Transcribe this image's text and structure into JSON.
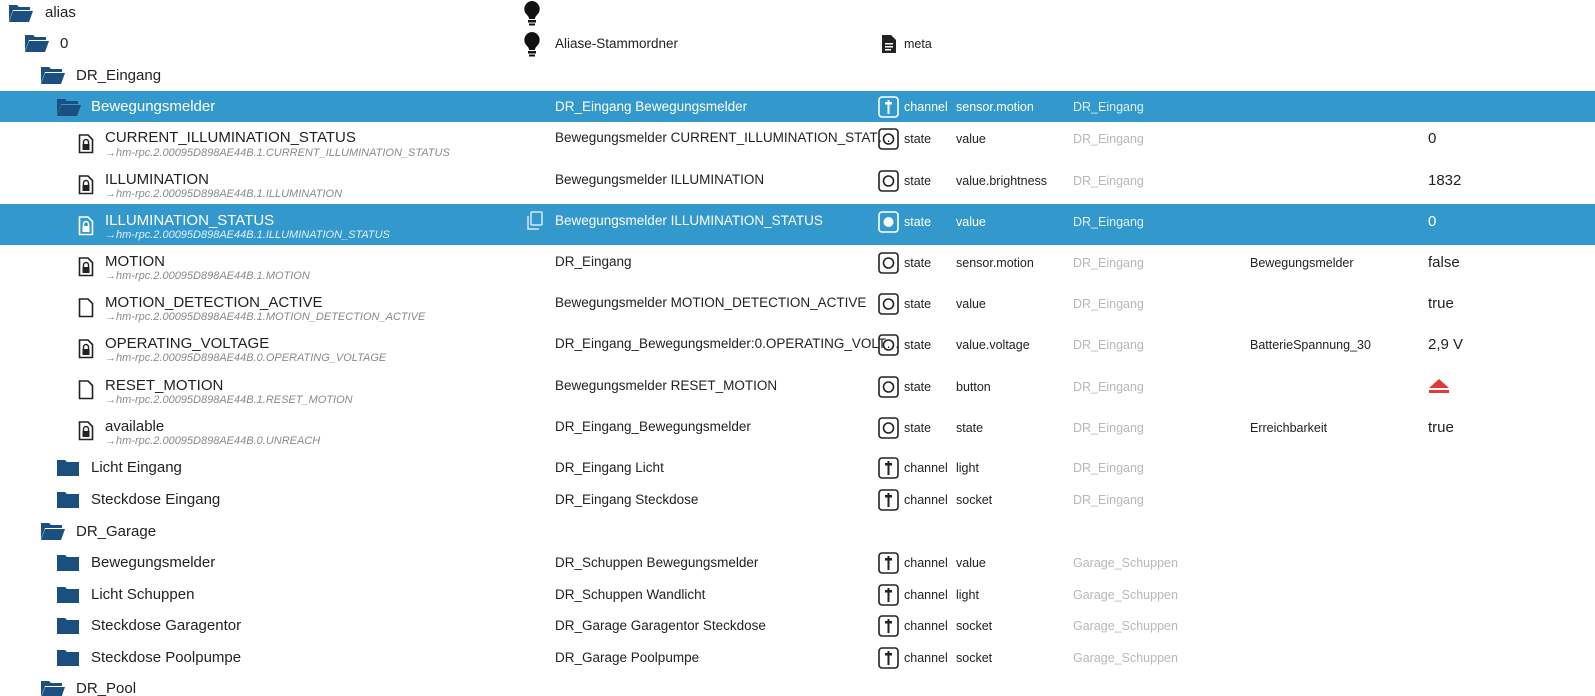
{
  "folders": [
    {
      "name": "alias",
      "title": ""
    },
    {
      "name": "0",
      "title": "Aliase-Stammordner",
      "type": "meta"
    },
    {
      "name": "DR_Eingang"
    },
    {
      "name": "Bewegungsmelder",
      "title": "DR_Eingang Bewegungsmelder",
      "type": "channel",
      "role": "sensor.motion",
      "room": "DR_Eingang"
    }
  ],
  "states": [
    {
      "name": "CURRENT_ILLUMINATION_STATUS",
      "alias": "→hm-rpc.2.00095D898AE44B.1.CURRENT_ILLUMINATION_STATUS",
      "title": "Bewegungsmelder CURRENT_ILLUMINATION_STAT…",
      "type": "state",
      "role": "value",
      "room": "DR_Eingang",
      "function": "",
      "value": "0"
    },
    {
      "name": "ILLUMINATION",
      "alias": "→hm-rpc.2.00095D898AE44B.1.ILLUMINATION",
      "title": "Bewegungsmelder ILLUMINATION",
      "type": "state",
      "role": "value.brightness",
      "room": "DR_Eingang",
      "function": "",
      "value": "1832"
    },
    {
      "name": "ILLUMINATION_STATUS",
      "alias": "→hm-rpc.2.00095D898AE44B.1.ILLUMINATION_STATUS",
      "title": "Bewegungsmelder ILLUMINATION_STATUS",
      "type": "state",
      "role": "value",
      "room": "DR_Eingang",
      "function": "",
      "value": "0"
    },
    {
      "name": "MOTION",
      "alias": "→hm-rpc.2.00095D898AE44B.1.MOTION",
      "title": "DR_Eingang",
      "type": "state",
      "role": "sensor.motion",
      "room": "DR_Eingang",
      "function": "Bewegungsmelder",
      "value": "false"
    },
    {
      "name": "MOTION_DETECTION_ACTIVE",
      "alias": "→hm-rpc.2.00095D898AE44B.1.MOTION_DETECTION_ACTIVE",
      "title": "Bewegungsmelder MOTION_DETECTION_ACTIVE",
      "type": "state",
      "role": "value",
      "room": "DR_Eingang",
      "function": "",
      "value": "true"
    },
    {
      "name": "OPERATING_VOLTAGE",
      "alias": "→hm-rpc.2.00095D898AE44B.0.OPERATING_VOLTAGE",
      "title": "DR_Eingang_Bewegungsmelder:0.OPERATING_VOLT…",
      "type": "state",
      "role": "value.voltage",
      "room": "DR_Eingang",
      "function": "BatterieSpannung_30",
      "value": "2,9 V"
    },
    {
      "name": "RESET_MOTION",
      "alias": "→hm-rpc.2.00095D898AE44B.1.RESET_MOTION",
      "title": "Bewegungsmelder RESET_MOTION",
      "type": "state",
      "role": "button",
      "room": "DR_Eingang",
      "function": "",
      "value": ""
    },
    {
      "name": "available",
      "alias": "→hm-rpc.2.00095D898AE44B.0.UNREACH",
      "title": "DR_Eingang_Bewegungsmelder",
      "type": "state",
      "role": "state",
      "room": "DR_Eingang",
      "function": "Erreichbarkeit",
      "value": "true"
    }
  ],
  "channels": [
    {
      "name": "Licht Eingang",
      "title": "DR_Eingang Licht",
      "type": "channel",
      "role": "light",
      "room": "DR_Eingang"
    },
    {
      "name": "Steckdose Eingang",
      "title": "DR_Eingang Steckdose",
      "type": "channel",
      "role": "socket",
      "room": "DR_Eingang"
    },
    {
      "name": "DR_Garage"
    },
    {
      "name": "Bewegungsmelder",
      "title": "DR_Schuppen Bewegungsmelder",
      "type": "channel",
      "role": "value",
      "room": "Garage_Schuppen"
    },
    {
      "name": "Licht Schuppen",
      "title": "DR_Schuppen Wandlicht",
      "type": "channel",
      "role": "light",
      "room": "Garage_Schuppen"
    },
    {
      "name": "Steckdose Garagentor",
      "title": "DR_Garage Garagentor Steckdose",
      "type": "channel",
      "role": "socket",
      "room": "Garage_Schuppen"
    },
    {
      "name": "Steckdose Poolpumpe",
      "title": "DR_Garage Poolpumpe",
      "type": "channel",
      "role": "socket",
      "room": "Garage_Schuppen"
    },
    {
      "name": "DR_Pool"
    }
  ],
  "icons": {
    "folder_open": "folder-open-icon",
    "folder": "folder-icon",
    "bulb": "lightbulb-icon",
    "file": "file-icon",
    "lock_file": "locked-file-icon",
    "channel": "channel-icon",
    "state": "state-icon",
    "copy": "copy-icon",
    "button": "eject-button-icon"
  },
  "colors": {
    "selected": "#3399cc",
    "folder": "#1a4f7f",
    "button_red": "#e03b3b",
    "room_text": "#b8b8b8"
  }
}
